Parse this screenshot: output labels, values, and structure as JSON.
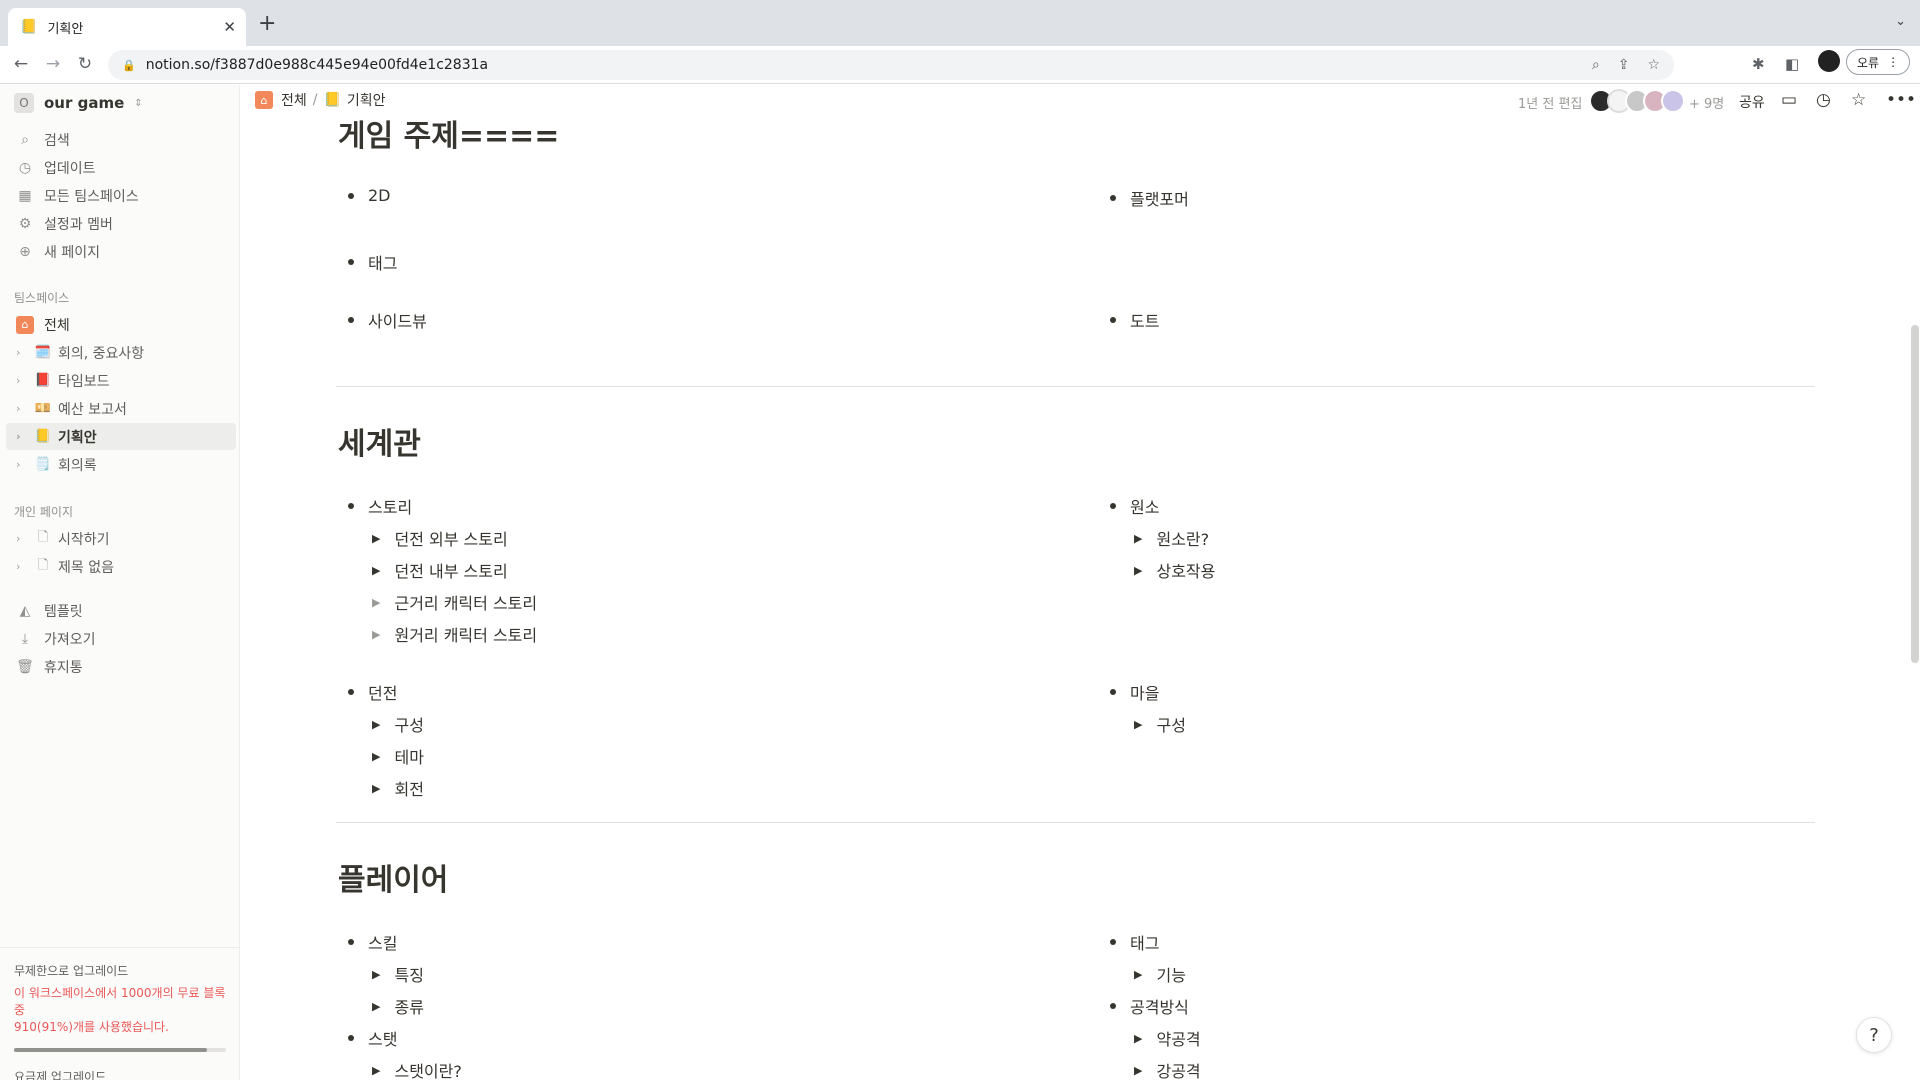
{
  "browser": {
    "tab_title": "기획안",
    "tab_icon": "📒",
    "url": "notion.so/f3887d0e988c445e94e00fd4e1c2831a",
    "error_label": "오류"
  },
  "sidebar": {
    "workspace_initial": "O",
    "workspace_name": "our game",
    "top_items": [
      {
        "label": "검색",
        "icon": "search-icon"
      },
      {
        "label": "업데이트",
        "icon": "clock-icon"
      },
      {
        "label": "모든 팀스페이스",
        "icon": "grid-icon"
      },
      {
        "label": "설정과 멤버",
        "icon": "gear-icon"
      },
      {
        "label": "새 페이지",
        "icon": "plus-circle-icon"
      }
    ],
    "teamspace_header": "팀스페이스",
    "teamspace_home": "전체",
    "teamspace_pages": [
      {
        "label": "회의, 중요사항",
        "emoji": "🗓️"
      },
      {
        "label": "타임보드",
        "emoji": "📕"
      },
      {
        "label": "예산 보고서",
        "emoji": "💴"
      },
      {
        "label": "기획안",
        "emoji": "📒",
        "active": true
      },
      {
        "label": "회의록",
        "emoji": "🗒️"
      }
    ],
    "private_header": "개인 페이지",
    "private_pages": [
      {
        "label": "시작하기"
      },
      {
        "label": "제목 없음"
      }
    ],
    "bottom_items": [
      {
        "label": "템플릿",
        "icon": "shapes-icon"
      },
      {
        "label": "가져오기",
        "icon": "download-icon"
      },
      {
        "label": "휴지통",
        "icon": "trash-icon"
      }
    ],
    "upgrade": {
      "title": "무제한으로 업그레이드",
      "warning_line1": "이 워크스페이스에서 1000개의 무료 블록 중",
      "warning_line2": "910(91%)개를 사용했습니다.",
      "usage_fraction": 0.91,
      "link": "요금제 업그레이드"
    }
  },
  "topbar": {
    "crumb_home": "전체",
    "crumb_sep": "/",
    "crumb_page": "기획안",
    "edited": "1년 전 편집",
    "more_count": "+ 9명",
    "share": "공유"
  },
  "sections": {
    "s1": {
      "title": "게임 주제====",
      "left": [
        "2D",
        "태그",
        "사이드뷰"
      ],
      "right": [
        "플랫포머",
        "도트"
      ]
    },
    "s2": {
      "title": "세계관",
      "story": "스토리",
      "story_toggles": [
        "던전 외부 스토리",
        "던전 내부 스토리",
        "근거리 캐릭터 스토리",
        "원거리 캐릭터 스토리"
      ],
      "element": "원소",
      "element_toggles": [
        "원소란?",
        "상호작용"
      ],
      "dungeon": "던전",
      "dungeon_toggles": [
        "구성",
        "테마",
        "회전"
      ],
      "village": "마을",
      "village_toggles": [
        "구성"
      ]
    },
    "s3": {
      "title": "플레이어",
      "skill": "스킬",
      "skill_toggles": [
        "특징",
        "종류"
      ],
      "stat": "스탯",
      "stat_toggles": [
        "스탯이란?"
      ],
      "tag": "태그",
      "tag_toggles": [
        "기능"
      ],
      "attack": "공격방식",
      "attack_toggles": [
        "약공격",
        "강공격"
      ]
    }
  },
  "help": "?"
}
